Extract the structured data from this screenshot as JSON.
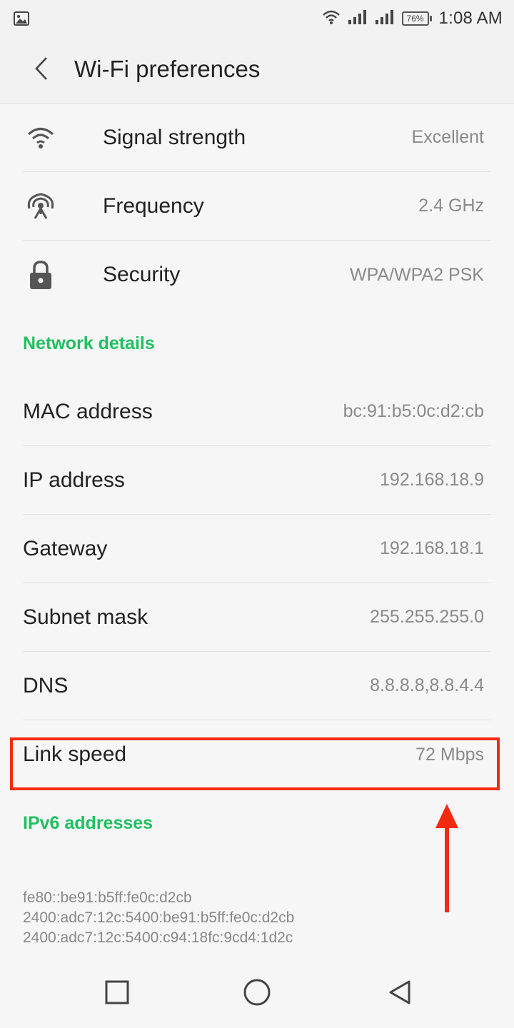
{
  "status_bar": {
    "time": "1:08 AM",
    "battery_percent": "76%",
    "icons": [
      "image-icon",
      "wifi-icon",
      "signal-icon",
      "signal-icon",
      "battery-icon"
    ]
  },
  "app_bar": {
    "title": "Wi-Fi preferences",
    "back_icon": "chevron-left-icon"
  },
  "summary": [
    {
      "label": "Signal strength",
      "value": "Excellent",
      "icon": "wifi-icon"
    },
    {
      "label": "Frequency",
      "value": "2.4 GHz",
      "icon": "antenna-icon"
    },
    {
      "label": "Security",
      "value": "WPA/WPA2 PSK",
      "icon": "lock-icon"
    }
  ],
  "network_details": {
    "header": "Network details",
    "rows": [
      {
        "label": "MAC address",
        "value": "bc:91:b5:0c:d2:cb"
      },
      {
        "label": "IP address",
        "value": "192.168.18.9"
      },
      {
        "label": "Gateway",
        "value": "192.168.18.1"
      },
      {
        "label": "Subnet mask",
        "value": "255.255.255.0"
      },
      {
        "label": "DNS",
        "value": "8.8.8.8,8.8.4.4"
      },
      {
        "label": "Link speed",
        "value": "72 Mbps"
      }
    ]
  },
  "ipv6": {
    "header": "IPv6 addresses",
    "addresses": [
      "fe80::be91:b5ff:fe0c:d2cb",
      "2400:adc7:12c:5400:be91:b5ff:fe0c:d2cb",
      "2400:adc7:12c:5400:c94:18fc:9cd4:1d2c"
    ]
  },
  "colors": {
    "accent_green": "#20c060",
    "highlight_red": "#f22b10"
  },
  "nav_bar": {
    "icons": [
      "square-icon",
      "circle-icon",
      "triangle-left-icon"
    ]
  }
}
